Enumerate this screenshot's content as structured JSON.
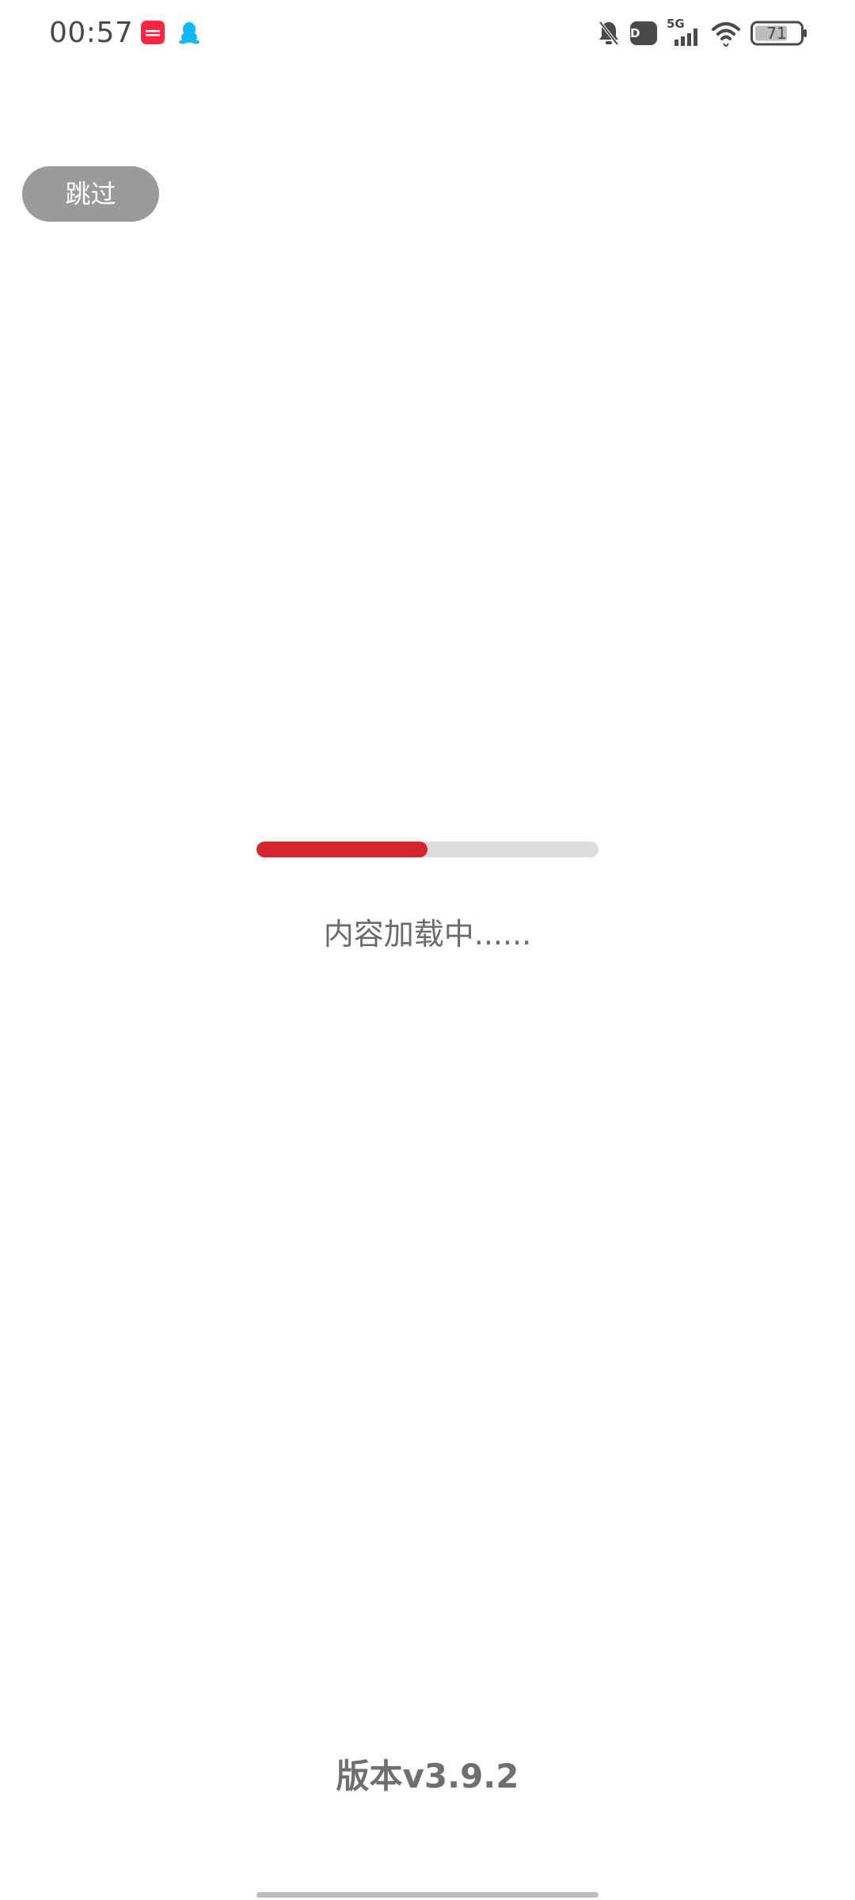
{
  "status_bar": {
    "time": "00:57",
    "left_icons": [
      "xiaohongshu-app-icon",
      "qq-app-icon"
    ],
    "right_icons": [
      "bell-muted-icon",
      "hd-icon",
      "5g-signal-icon",
      "wifi-icon",
      "battery-icon"
    ],
    "hd_label": "HD",
    "network_label": "5G",
    "battery_level": "71",
    "colors": {
      "xiaohongshu": "#ff2442",
      "qq": "#12b7f5"
    }
  },
  "skip_button": {
    "label": "跳过"
  },
  "loading": {
    "progress": 0.5,
    "text": "内容加载中......",
    "colors": {
      "fill": "#d7262b",
      "track": "#dcdcdc"
    }
  },
  "footer": {
    "version": "版本v3.9.2"
  }
}
